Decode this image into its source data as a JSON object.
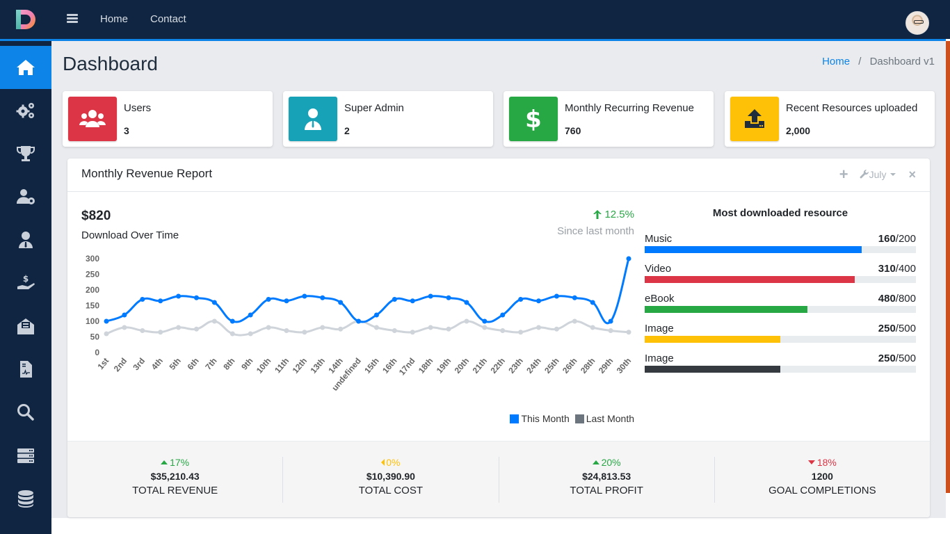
{
  "topnav": {
    "links": [
      "Home",
      "Contact"
    ]
  },
  "sidebar": {
    "items": [
      {
        "icon": "home-icon",
        "active": true
      },
      {
        "icon": "gears-icon",
        "active": false
      },
      {
        "icon": "trophy-icon",
        "active": false
      },
      {
        "icon": "user-gear-icon",
        "active": false
      },
      {
        "icon": "user-tie-icon",
        "active": false
      },
      {
        "icon": "hand-dollar-icon",
        "active": false
      },
      {
        "icon": "envelope-open-icon",
        "active": false
      },
      {
        "icon": "file-medical-icon",
        "active": false
      },
      {
        "icon": "search-icon",
        "active": false
      },
      {
        "icon": "server-icon",
        "active": false
      },
      {
        "icon": "database-icon",
        "active": false
      }
    ]
  },
  "page": {
    "title": "Dashboard",
    "breadcrumb": {
      "home": "Home",
      "separator": "/",
      "current": "Dashboard v1"
    }
  },
  "info_boxes": [
    {
      "label": "Users",
      "value": "3",
      "color": "#dc3545",
      "icon": "users-icon"
    },
    {
      "label": "Super Admin",
      "value": "2",
      "color": "#17a2b8",
      "icon": "user-tie-icon"
    },
    {
      "label": "Monthly Recurring Revenue",
      "value": "760",
      "color": "#28a745",
      "icon": "dollar-icon"
    },
    {
      "label": "Recent Resources uploaded",
      "value": "2,000",
      "color": "#ffc107",
      "icon": "upload-icon"
    }
  ],
  "report": {
    "title": "Monthly Revenue Report",
    "month_selector": "July",
    "amount": "$820",
    "subtitle": "Download Over Time",
    "change": "12.5%",
    "since": "Since last month"
  },
  "chart_data": {
    "type": "line",
    "title": "Download Over Time",
    "x": [
      "1st",
      "2nd",
      "3rd",
      "4th",
      "5th",
      "6th",
      "7th",
      "8th",
      "9th",
      "10th",
      "11th",
      "12th",
      "13th",
      "14th",
      "undefined",
      "15th",
      "16th",
      "17nd",
      "18th",
      "19th",
      "20th",
      "21th",
      "22th",
      "23th",
      "24th",
      "25th",
      "26th",
      "28th",
      "29th",
      "30th"
    ],
    "series": [
      {
        "name": "This Month",
        "color": "#007bff",
        "values": [
          100,
          120,
          170,
          165,
          180,
          175,
          160,
          100,
          120,
          170,
          165,
          180,
          175,
          160,
          100,
          120,
          170,
          165,
          180,
          175,
          160,
          100,
          120,
          170,
          165,
          180,
          175,
          160,
          100,
          300
        ]
      },
      {
        "name": "Last Month",
        "color": "#ced4da",
        "legend_color": "#6c757d",
        "values": [
          60,
          80,
          70,
          65,
          80,
          75,
          100,
          60,
          60,
          80,
          70,
          65,
          80,
          75,
          100,
          80,
          70,
          65,
          80,
          75,
          100,
          80,
          70,
          65,
          80,
          75,
          100,
          80,
          70,
          65
        ]
      }
    ],
    "yticks": [
      0,
      50,
      100,
      150,
      200,
      250,
      300
    ],
    "ylim": [
      0,
      300
    ],
    "xlabel": "",
    "ylabel": "",
    "grid": false,
    "legend": "bottom-right"
  },
  "resources": {
    "title": "Most downloaded resource",
    "items": [
      {
        "label": "Music",
        "value": 160,
        "max": 200,
        "value_text": "160",
        "max_text": "/200",
        "color": "#007bff"
      },
      {
        "label": "Video",
        "value": 310,
        "max": 400,
        "value_text": "310",
        "max_text": "/400",
        "color": "#dc3545"
      },
      {
        "label": "eBook",
        "value": 480,
        "max": 800,
        "value_text": "480",
        "max_text": "/800",
        "color": "#28a745"
      },
      {
        "label": "Image",
        "value": 250,
        "max": 500,
        "value_text": "250",
        "max_text": "/500",
        "color": "#ffc107"
      },
      {
        "label": "Image",
        "value": 250,
        "max": 500,
        "value_text": "250",
        "max_text": "/500",
        "color": "#343a40"
      }
    ]
  },
  "footer_stats": [
    {
      "change": "17%",
      "direction": "up",
      "color": "#28a745",
      "amount": "$35,210.43",
      "label": "Total Revenue"
    },
    {
      "change": "0%",
      "direction": "left",
      "color": "#ffc107",
      "amount": "$10,390.90",
      "label": "Total Cost"
    },
    {
      "change": "20%",
      "direction": "up",
      "color": "#28a745",
      "amount": "$24,813.53",
      "label": "Total Profit"
    },
    {
      "change": "18%",
      "direction": "down",
      "color": "#dc3545",
      "amount": "1200",
      "label": "Goal Completions"
    }
  ]
}
